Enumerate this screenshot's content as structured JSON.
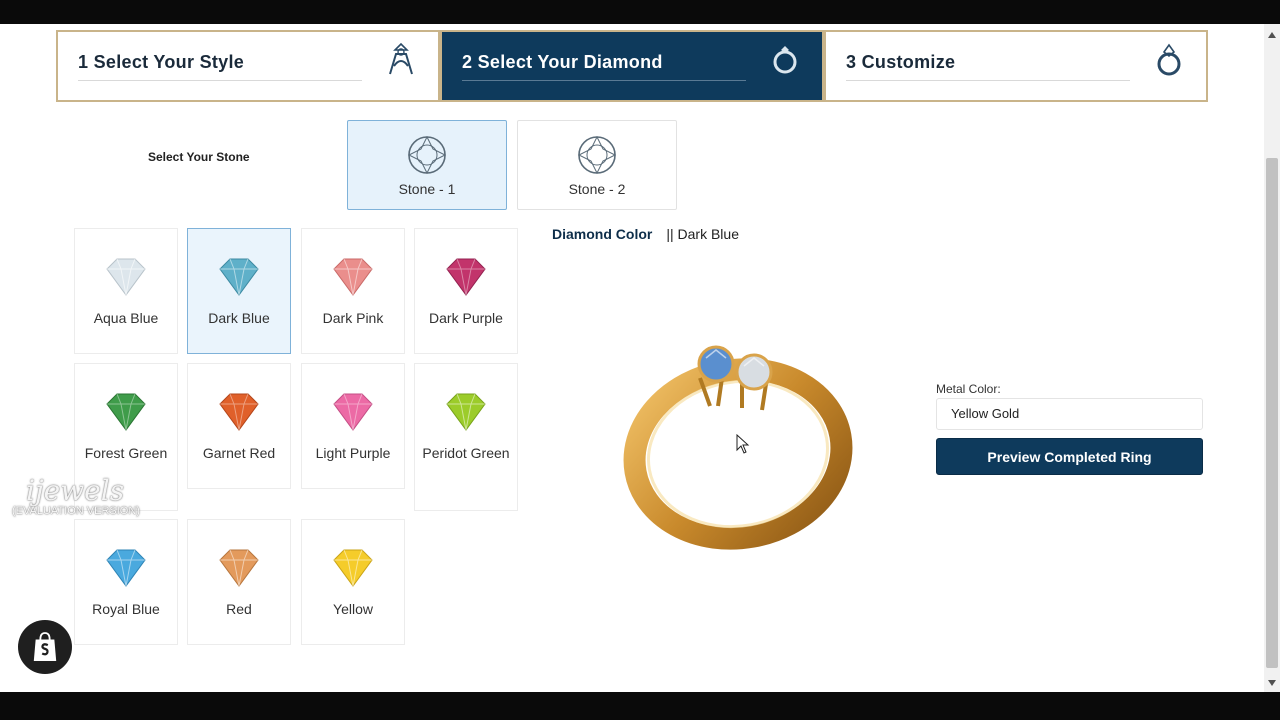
{
  "steps": [
    {
      "label": "1 Select Your Style",
      "icon": "ring-style-icon",
      "active": false
    },
    {
      "label": "2 Select Your Diamond",
      "icon": "diamond-ring-icon",
      "active": true
    },
    {
      "label": "3 Customize",
      "icon": "ring-icon",
      "active": false
    }
  ],
  "stone_selector": {
    "label": "Select Your Stone",
    "stones": [
      {
        "label": "Stone - 1",
        "selected": true
      },
      {
        "label": "Stone - 2",
        "selected": false
      }
    ]
  },
  "gem_colors": [
    {
      "name": "Aqua Blue",
      "color": "#dde6ec"
    },
    {
      "name": "Dark Blue",
      "color": "#5fb0c9",
      "selected": true
    },
    {
      "name": "Dark Pink",
      "color": "#ea8e8c"
    },
    {
      "name": "Dark Purple",
      "color": "#c2346b"
    },
    {
      "name": "Forest Green",
      "color": "#3f9c4a"
    },
    {
      "name": "Garnet Red",
      "color": "#e0602a"
    },
    {
      "name": "Light Purple",
      "color": "#ec6aa5"
    },
    {
      "name": "Peridot Green",
      "color": "#9ccc2a"
    },
    {
      "name": "Royal Blue",
      "color": "#4aa9de"
    },
    {
      "name": "Red",
      "color": "#e39a5c"
    },
    {
      "name": "Yellow",
      "color": "#f5cc2a"
    }
  ],
  "diamond_color": {
    "label": "Diamond Color",
    "value": "|| Dark Blue"
  },
  "metal": {
    "label": "Metal Color:",
    "value": "Yellow Gold"
  },
  "preview_button": "Preview Completed Ring",
  "watermark": {
    "brand": "ijewels",
    "note": "(EVALUATION VERSION)"
  },
  "colors": {
    "navy": "#0e3a5c",
    "gold_border": "#c9b48a",
    "selected_bg": "#eaf4fc"
  }
}
